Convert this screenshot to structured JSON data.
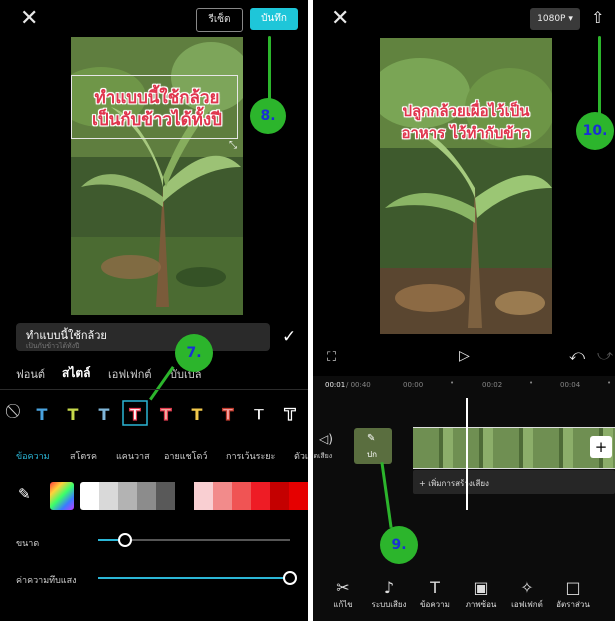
{
  "left": {
    "close_icon": "close-icon",
    "reset_label": "รีเซ็ต",
    "save_label": "บันทึก",
    "video_caption": [
      "ทำแบบนี้ใช้กล้วย",
      "เป็นกับข้าวได้ทั้งปี"
    ],
    "text_input_value": "ทำแบบนี้ใช้กล้วย",
    "text_input_value_line2": "เป็นกับข้าวได้ทั้งปี",
    "tabs": [
      "ฟอนต์",
      "สไตล์",
      "เอฟเฟกต์",
      "บับเบิล"
    ],
    "active_tab_index": 1,
    "subtabs": [
      "ข้อความ",
      "สโตรค",
      "แคนวาส",
      "อายแชโดว์",
      "การเว้นระยะ",
      "ตัวเอียง"
    ],
    "active_subtab_index": 0,
    "style_swatches": [
      {
        "fill": "#4aa3df",
        "stroke": "none"
      },
      {
        "fill": "#c5d84a",
        "stroke": "none"
      },
      {
        "fill": "#7fb6d9",
        "stroke": "none"
      },
      {
        "fill": "#ffffff",
        "stroke": "#e23b4f"
      },
      {
        "fill": "#f3b3a6",
        "stroke": "#e23b4f"
      },
      {
        "fill": "#f2c94c",
        "stroke": "none"
      },
      {
        "fill": "#f7a8a8",
        "stroke": "#c0392b"
      },
      {
        "fill": "#ffffff",
        "stroke": "#000000"
      },
      {
        "fill": "#000000",
        "stroke": "#ffffff"
      }
    ],
    "colors": [
      "#ffffff",
      "#d9d9d9",
      "#b3b3b3",
      "#8c8c8c",
      "#595959",
      "#000000",
      "#f9cfd2",
      "#f28b8b",
      "#f05454",
      "#ee1c25",
      "#c40000",
      "#e60000"
    ],
    "size_label": "ขนาด",
    "size_value": 0.14,
    "opacity_label": "ค่าความทึบแสง",
    "opacity_value": 1.0,
    "marker_7": "7.",
    "marker_8": "8."
  },
  "right": {
    "close_icon": "close-icon",
    "resolution_label": "1080P ▾",
    "export_icon": "upload-icon",
    "video_caption": [
      "ปลูกกล้วยเผื่อไว้เป็น",
      "อาหาร ไว้ทำกับข้าว"
    ],
    "time_current": "00:01",
    "time_total": "/ 00:40",
    "ruler": [
      "00:00",
      "00:02",
      "00:04"
    ],
    "mute_label": "ปิดเสียง",
    "cover_label": "ปก",
    "add_audio_label": "+ เพิ่มการสร้างเสียง",
    "tools": [
      {
        "icon": "✂",
        "label": "แก้ไข"
      },
      {
        "icon": "♪",
        "label": "ระบบเสียง"
      },
      {
        "icon": "T",
        "label": "ข้อความ"
      },
      {
        "icon": "▣",
        "label": "ภาพซ้อน"
      },
      {
        "icon": "✧",
        "label": "เอฟเฟกต์"
      },
      {
        "icon": "□",
        "label": "อัตราส่วน"
      },
      {
        "icon": "",
        "label": "ฟิ"
      }
    ],
    "marker_9": "9.",
    "marker_10": "10."
  }
}
